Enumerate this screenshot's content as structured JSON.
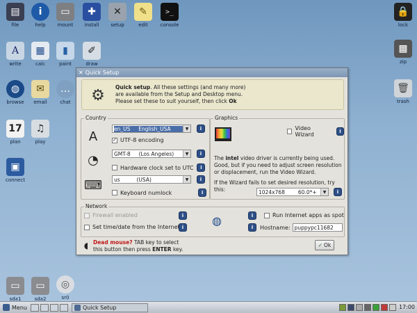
{
  "desktop": {
    "icons": [
      {
        "label": "file",
        "icon": "folder-icon",
        "glyph": "▤"
      },
      {
        "label": "help",
        "icon": "help-icon",
        "glyph": "i"
      },
      {
        "label": "mount",
        "icon": "drive-icon",
        "glyph": "▭"
      },
      {
        "label": "install",
        "icon": "install-icon",
        "glyph": "✚"
      },
      {
        "label": "setup",
        "icon": "tools-icon",
        "glyph": "✕"
      },
      {
        "label": "edit",
        "icon": "notepad-icon",
        "glyph": "✎"
      },
      {
        "label": "console",
        "icon": "terminal-icon",
        "glyph": ">_"
      },
      {
        "label": "write",
        "icon": "write-icon",
        "glyph": "A"
      },
      {
        "label": "calc",
        "icon": "spreadsheet-icon",
        "glyph": "▦"
      },
      {
        "label": "paint",
        "icon": "paint-roller-icon",
        "glyph": "▮"
      },
      {
        "label": "draw",
        "icon": "draw-icon",
        "glyph": "✐"
      },
      {
        "label": "browse",
        "icon": "globe-icon",
        "glyph": "◍"
      },
      {
        "label": "email",
        "icon": "envelope-icon",
        "glyph": "✉"
      },
      {
        "label": "chat",
        "icon": "chat-icon",
        "glyph": "…"
      },
      {
        "label": "plan",
        "icon": "calendar-icon",
        "glyph": "17"
      },
      {
        "label": "play",
        "icon": "music-icon",
        "glyph": "♫"
      },
      {
        "label": "connect",
        "icon": "network-icon",
        "glyph": "▣"
      },
      {
        "label": "lock",
        "icon": "lock-icon",
        "glyph": "🔒"
      },
      {
        "label": "zip",
        "icon": "archive-icon",
        "glyph": "▩"
      },
      {
        "label": "trash",
        "icon": "trash-icon",
        "glyph": "🗑"
      },
      {
        "label": "sda1",
        "icon": "drive-icon",
        "glyph": "▭"
      },
      {
        "label": "sda2",
        "icon": "drive-icon",
        "glyph": "▭"
      },
      {
        "label": "sr0",
        "icon": "cdrom-icon",
        "glyph": "◎"
      }
    ]
  },
  "window": {
    "title": "Quick Setup",
    "intro_bold": "Quick setup",
    "intro_line1_rest": ". All these settings (and many more)",
    "intro_line2": "are available from the Setup and Desktop menu.",
    "intro_line3_pre": "Please set these to suit yourself, then click ",
    "intro_line3_bold": "Ok",
    "country": {
      "label": "Country",
      "locale_value": "en_US     English_USA",
      "utf8_label": "UTF-8 encoding",
      "utf8_checked": true,
      "timezone_value": "GMT-8     (Los Angeles)",
      "hwclock_label": "Hardware clock set to UTC",
      "hwclock_checked": false,
      "keyboard_value": "us          (USA)",
      "numlock_label": "Keyboard numlock",
      "numlock_checked": false
    },
    "graphics": {
      "label": "Graphics",
      "video_wizard_label": "Video Wizard",
      "video_wizard_checked": false,
      "desc_line1_pre": "The ",
      "desc_line1_bold": "intel",
      "desc_line1_rest": " video driver is currently being used.",
      "desc_line2": "Good, but if you need to adjust screen resolution",
      "desc_line3": "or displacement, run the Video Wizard.",
      "wizard_fail_text": "If the Wizard fails to set desired resolution, try this:",
      "resolution_value": "1024x768        60.0*+"
    },
    "network": {
      "label": "Network",
      "firewall_label": "Firewall enabled",
      "firewall_checked": false,
      "settime_label": "Set time/date from the Internet",
      "settime_checked": false,
      "spot_label": "Run Internet apps as spot",
      "spot_checked": false,
      "hostname_label": "Hostname:",
      "hostname_value": "puppypc11682"
    },
    "footer": {
      "dead_mouse_bold": "Dead mouse?",
      "dead_mouse_rest": " TAB key to select",
      "line2_pre": "this button then press ",
      "line2_bold": "ENTER",
      "line2_post": " key."
    },
    "ok_label": "Ok"
  },
  "taskbar": {
    "menu_label": "Menu",
    "task_label": "Quick Setup",
    "clock": "17:00"
  }
}
